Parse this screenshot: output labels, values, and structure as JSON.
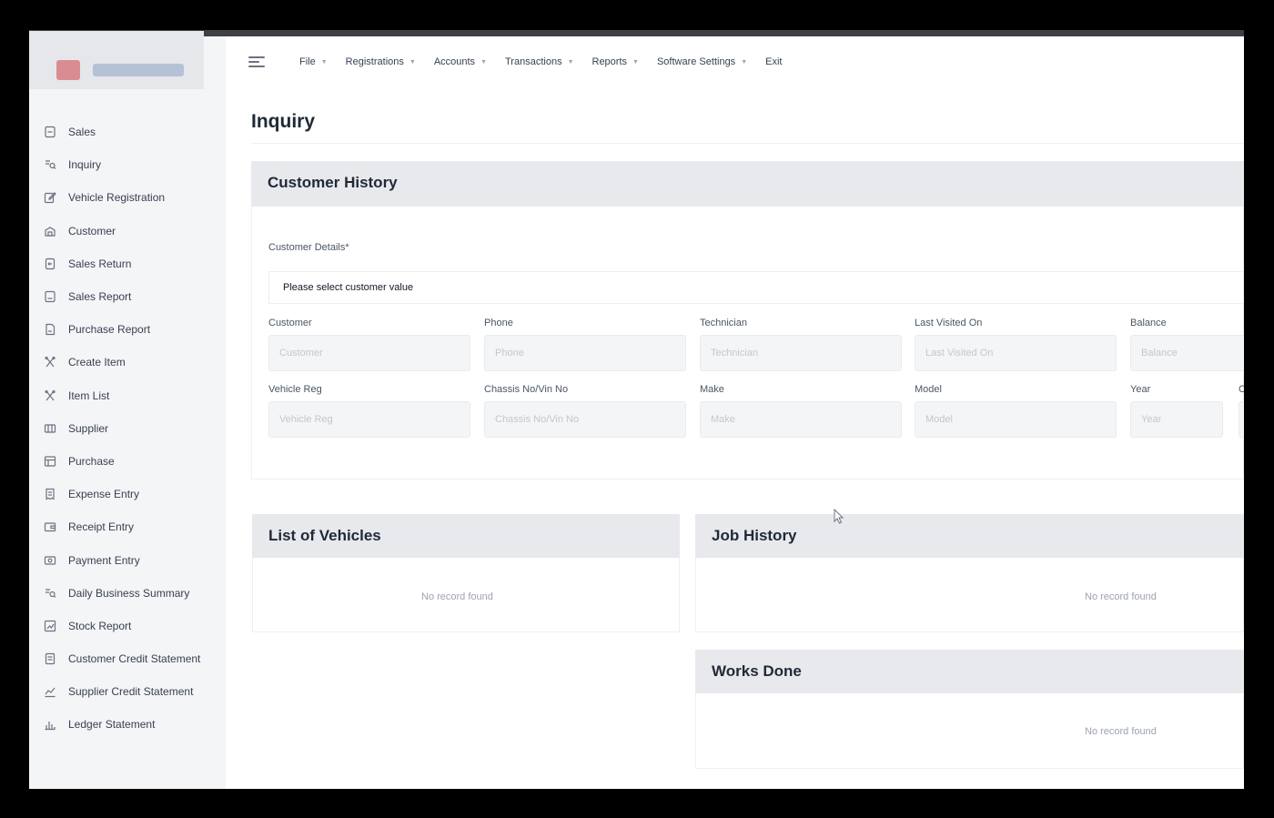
{
  "sidebar": {
    "items": [
      {
        "label": "Sales",
        "icon": "document-icon"
      },
      {
        "label": "Inquiry",
        "icon": "inquiry-icon"
      },
      {
        "label": "Vehicle Registration",
        "icon": "edit-icon"
      },
      {
        "label": "Customer",
        "icon": "customer-icon"
      },
      {
        "label": "Sales Return",
        "icon": "return-icon"
      },
      {
        "label": "Sales Report",
        "icon": "report-icon"
      },
      {
        "label": "Purchase Report",
        "icon": "file-icon"
      },
      {
        "label": "Create Item",
        "icon": "tools-icon"
      },
      {
        "label": "Item List",
        "icon": "tools-icon"
      },
      {
        "label": "Supplier",
        "icon": "supplier-icon"
      },
      {
        "label": "Purchase",
        "icon": "purchase-icon"
      },
      {
        "label": "Expense Entry",
        "icon": "receipt-icon"
      },
      {
        "label": "Receipt Entry",
        "icon": "wallet-icon"
      },
      {
        "label": "Payment Entry",
        "icon": "payment-icon"
      },
      {
        "label": "Daily Business Summary",
        "icon": "summary-icon"
      },
      {
        "label": "Stock Report",
        "icon": "stock-icon"
      },
      {
        "label": "Customer Credit Statement",
        "icon": "statement-icon"
      },
      {
        "label": "Supplier Credit Statement",
        "icon": "chart-icon"
      },
      {
        "label": "Ledger Statement",
        "icon": "ledger-icon"
      }
    ]
  },
  "menu": {
    "items": [
      {
        "label": "File",
        "caret": true
      },
      {
        "label": "Registrations",
        "caret": true
      },
      {
        "label": "Accounts",
        "caret": true
      },
      {
        "label": "Transactions",
        "caret": true
      },
      {
        "label": "Reports",
        "caret": true
      },
      {
        "label": "Software Settings",
        "caret": true
      },
      {
        "label": "Exit",
        "caret": false
      }
    ]
  },
  "page": {
    "title": "Inquiry"
  },
  "customer_history": {
    "title": "Customer History",
    "details_label": "Customer Details*",
    "select_placeholder": "Please select customer value",
    "fields_row1": [
      {
        "label": "Customer",
        "placeholder": "Customer"
      },
      {
        "label": "Phone",
        "placeholder": "Phone"
      },
      {
        "label": "Technician",
        "placeholder": "Technician"
      },
      {
        "label": "Last Visited On",
        "placeholder": "Last Visited On"
      },
      {
        "label": "Balance",
        "placeholder": "Balance"
      }
    ],
    "fields_row2": [
      {
        "label": "Vehicle Reg",
        "placeholder": "Vehicle Reg"
      },
      {
        "label": "Chassis No/Vin No",
        "placeholder": "Chassis No/Vin No"
      },
      {
        "label": "Make",
        "placeholder": "Make"
      },
      {
        "label": "Model",
        "placeholder": "Model"
      },
      {
        "label": "Year",
        "placeholder": "Year"
      },
      {
        "label": "C",
        "placeholder": ""
      }
    ]
  },
  "list_of_vehicles": {
    "title": "List of Vehicles",
    "empty": "No record found"
  },
  "job_history": {
    "title": "Job History",
    "empty": "No record found"
  },
  "works_done": {
    "title": "Works Done",
    "empty": "No record found"
  }
}
